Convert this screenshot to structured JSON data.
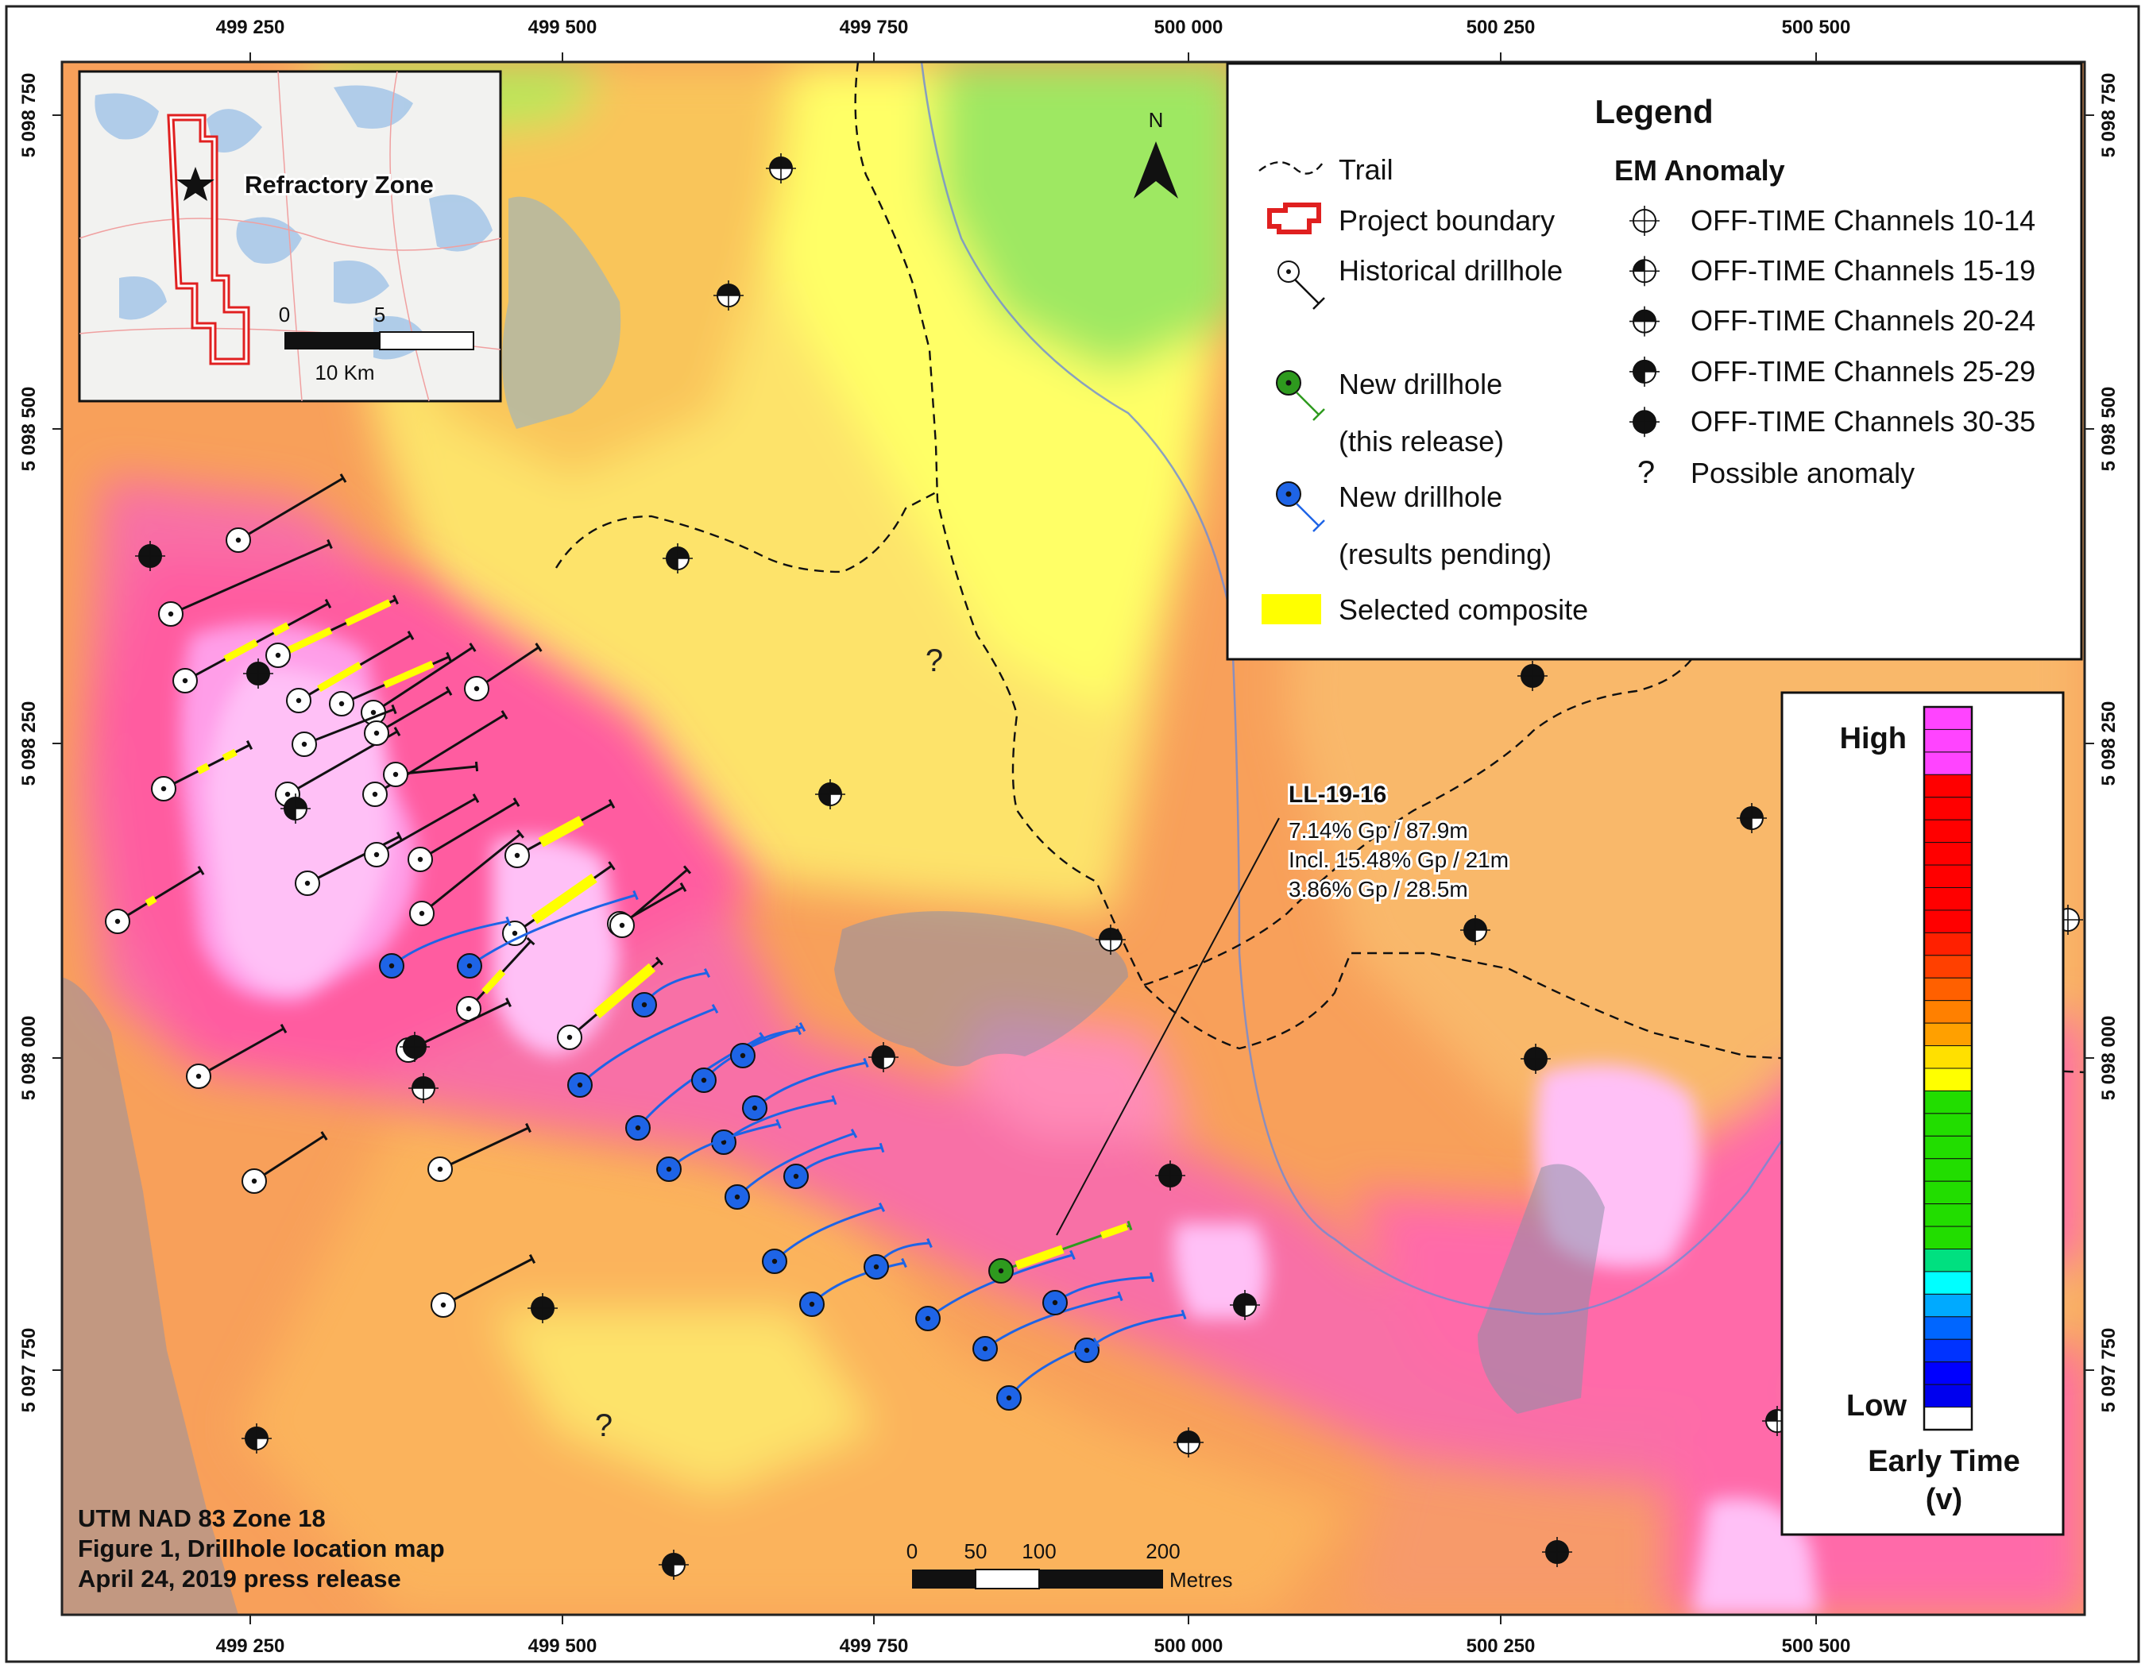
{
  "grid": {
    "x_labels": [
      "499 250",
      "499 500",
      "499 750",
      "500 000",
      "500 250",
      "500 500"
    ],
    "y_labels": [
      "5 098 750",
      "5 098 500",
      "5 098 250",
      "5 098 000",
      "5 097 750"
    ]
  },
  "inset": {
    "place_label": "Refractory Zone",
    "scale_start": "0",
    "scale_mid": "5",
    "scale_unit": "10 Km"
  },
  "north_arrow": {
    "label": "N"
  },
  "legend": {
    "title": "Legend",
    "trail": "Trail",
    "project_boundary": "Project boundary",
    "historical_drillhole": "Historical drillhole",
    "new_drillhole_release_1": "New drillhole",
    "new_drillhole_release_2": "(this release)",
    "new_drillhole_pending_1": "New drillhole",
    "new_drillhole_pending_2": "(results pending)",
    "selected_composite": "Selected composite",
    "em_title": "EM Anomaly",
    "em_items": [
      "OFF-TIME Channels 10-14",
      "OFF-TIME Channels 15-19",
      "OFF-TIME Channels 20-24",
      "OFF-TIME Channels 25-29",
      "OFF-TIME Channels 30-35"
    ],
    "possible_symbol": "?",
    "possible_label": "Possible anomaly",
    "colors": {
      "release": "#2e9a1e",
      "pending": "#1e64e6",
      "composite": "#ffff00",
      "boundary": "#e02020"
    }
  },
  "callout": {
    "hole_id": "LL-19-16",
    "line1": "7.14% Gp / 87.9m",
    "line2": "Incl. 15.48% Gp / 21m",
    "line3": "3.86% Gp / 28.5m"
  },
  "possible_marks": [
    "?",
    "?"
  ],
  "colorbar": {
    "high": "High",
    "low": "Low",
    "title_line1": "Early Time",
    "title_line2": "(v)",
    "colors": [
      "#ff44ff",
      "#ff44ff",
      "#ff44ff",
      "#ff0000",
      "#ff0000",
      "#ff0000",
      "#ff0000",
      "#ff0000",
      "#ff0000",
      "#ff0000",
      "#ff2000",
      "#ff4000",
      "#ff6000",
      "#ff8000",
      "#ffa000",
      "#ffe000",
      "#ffff00",
      "#22dd00",
      "#22dd00",
      "#22dd00",
      "#22dd00",
      "#22dd00",
      "#22dd00",
      "#22dd00",
      "#00e080",
      "#00ffff",
      "#00aaff",
      "#0066ff",
      "#0033ff",
      "#0000ff",
      "#0000ee",
      "#ffffff"
    ]
  },
  "footer": {
    "line1": "UTM NAD 83 Zone 18",
    "line2": "Figure 1, Drillhole location map",
    "line3": "April 24, 2019 press release"
  },
  "scalebar": {
    "labels": [
      "0",
      "50",
      "100",
      "200"
    ],
    "unit": "Metres"
  }
}
